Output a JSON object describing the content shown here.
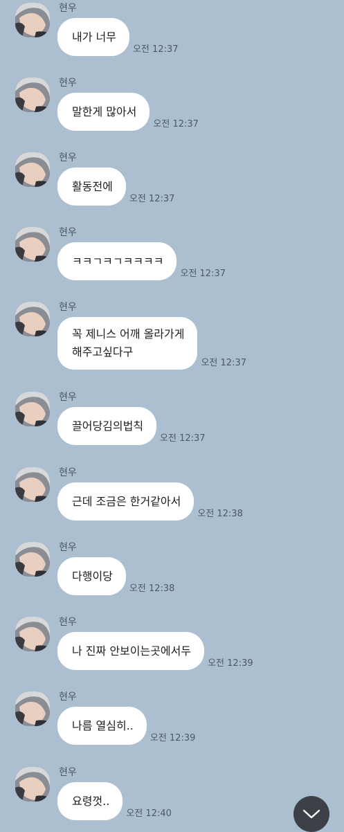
{
  "sender_name": "현우",
  "messages": [
    {
      "lines": [
        "내가 너무"
      ],
      "time": "오전 12:37"
    },
    {
      "lines": [
        "말한게 많아서"
      ],
      "time": "오전 12:37"
    },
    {
      "lines": [
        "활동전에"
      ],
      "time": "오전 12:37"
    },
    {
      "lines": [
        "ㅋㅋㄱㅋㄱㅋㅋㅋㅋ"
      ],
      "time": "오전 12:37"
    },
    {
      "lines": [
        "꼭 제니스 어깨 올라가게",
        "해주고싶다구"
      ],
      "time": "오전 12:37"
    },
    {
      "lines": [
        "끌어당김의법칙"
      ],
      "time": "오전 12:37"
    },
    {
      "lines": [
        "근데 조금은 한거같아서"
      ],
      "time": "오전 12:38"
    },
    {
      "lines": [
        "다행이당"
      ],
      "time": "오전 12:38"
    },
    {
      "lines": [
        "나 진짜 안보이는곳에서두"
      ],
      "time": "오전 12:39"
    },
    {
      "lines": [
        "나름 열심히.."
      ],
      "time": "오전 12:39"
    },
    {
      "lines": [
        "요령껏.."
      ],
      "time": "오전 12:40"
    }
  ],
  "icons": {
    "avatar": "profile-photo",
    "scroll_down": "chevron-down-icon"
  },
  "colors": {
    "background": "#abbfd0",
    "bubble": "#ffffff",
    "scroll_button": "#3d4046"
  }
}
